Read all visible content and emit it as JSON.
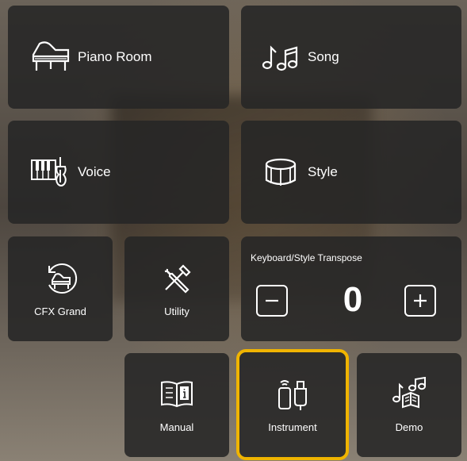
{
  "tiles": {
    "piano_room": {
      "label": "Piano Room",
      "icon": "grand-piano-icon"
    },
    "song": {
      "label": "Song",
      "icon": "music-notes-icon"
    },
    "voice": {
      "label": "Voice",
      "icon": "keyboard-violin-icon"
    },
    "style": {
      "label": "Style",
      "icon": "drum-icon"
    },
    "cfx_grand": {
      "label": "CFX Grand",
      "icon": "piano-reset-icon"
    },
    "utility": {
      "label": "Utility",
      "icon": "tools-icon"
    },
    "manual": {
      "label": "Manual",
      "icon": "book-info-icon"
    },
    "instrument": {
      "label": "Instrument",
      "icon": "phone-usb-icon",
      "selected": true
    },
    "demo": {
      "label": "Demo",
      "icon": "demo-notes-icon"
    }
  },
  "transpose": {
    "title": "Keyboard/Style Transpose",
    "value": "0",
    "minus_icon": "minus-icon",
    "plus_icon": "plus-icon"
  },
  "colors": {
    "selection": "#f0b400",
    "tile": "#262626",
    "text": "#ffffff"
  }
}
